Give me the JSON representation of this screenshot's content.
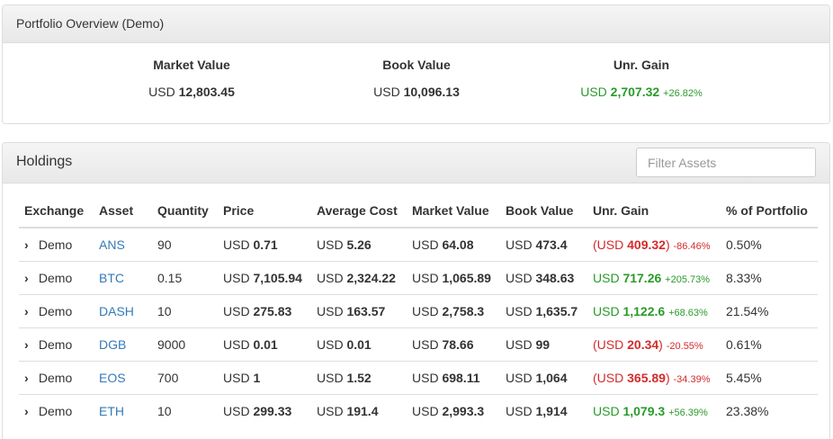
{
  "overview": {
    "title": "Portfolio Overview (Demo)",
    "market_value_label": "Market Value",
    "market_value_currency": "USD",
    "market_value": "12,803.45",
    "book_value_label": "Book Value",
    "book_value_currency": "USD",
    "book_value": "10,096.13",
    "gain_label": "Unr. Gain",
    "gain_currency": "USD",
    "gain_value": "2,707.32",
    "gain_pct": "+26.82%"
  },
  "holdings": {
    "title": "Holdings",
    "filter_placeholder": "Filter Assets",
    "columns": [
      "Exchange",
      "Asset",
      "Quantity",
      "Price",
      "Average Cost",
      "Market Value",
      "Book Value",
      "Unr. Gain",
      "% of Portfolio"
    ],
    "rows": [
      {
        "exchange": "Demo",
        "asset": "ANS",
        "quantity": "90",
        "price": "0.71",
        "avg_cost": "5.26",
        "market_value": "64.08",
        "book_value": "473.4",
        "gain_text": "(USD ",
        "gain_value": "409.32",
        "gain_close": ")",
        "gain_pct": "-86.46%",
        "gain_status": "loss",
        "portfolio_pct": "0.50%"
      },
      {
        "exchange": "Demo",
        "asset": "BTC",
        "quantity": "0.15",
        "price": "7,105.94",
        "avg_cost": "2,324.22",
        "market_value": "1,065.89",
        "book_value": "348.63",
        "gain_text": "USD ",
        "gain_value": "717.26",
        "gain_close": "",
        "gain_pct": "+205.73%",
        "gain_status": "gain",
        "portfolio_pct": "8.33%"
      },
      {
        "exchange": "Demo",
        "asset": "DASH",
        "quantity": "10",
        "price": "275.83",
        "avg_cost": "163.57",
        "market_value": "2,758.3",
        "book_value": "1,635.7",
        "gain_text": "USD ",
        "gain_value": "1,122.6",
        "gain_close": "",
        "gain_pct": "+68.63%",
        "gain_status": "gain",
        "portfolio_pct": "21.54%"
      },
      {
        "exchange": "Demo",
        "asset": "DGB",
        "quantity": "9000",
        "price": "0.01",
        "avg_cost": "0.01",
        "market_value": "78.66",
        "book_value": "99",
        "gain_text": "(USD ",
        "gain_value": "20.34",
        "gain_close": ")",
        "gain_pct": "-20.55%",
        "gain_status": "loss",
        "portfolio_pct": "0.61%"
      },
      {
        "exchange": "Demo",
        "asset": "EOS",
        "quantity": "700",
        "price": "1",
        "avg_cost": "1.52",
        "market_value": "698.11",
        "book_value": "1,064",
        "gain_text": "(USD ",
        "gain_value": "365.89",
        "gain_close": ")",
        "gain_pct": "-34.39%",
        "gain_status": "loss",
        "portfolio_pct": "5.45%"
      },
      {
        "exchange": "Demo",
        "asset": "ETH",
        "quantity": "10",
        "price": "299.33",
        "avg_cost": "191.4",
        "market_value": "2,993.3",
        "book_value": "1,914",
        "gain_text": "USD ",
        "gain_value": "1,079.3",
        "gain_close": "",
        "gain_pct": "+56.39%",
        "gain_status": "gain",
        "portfolio_pct": "23.38%"
      }
    ],
    "currency": "USD",
    "expand_icon": "chevron-right-icon"
  },
  "colors": {
    "gain": "#2a9a2a",
    "loss": "#d42b2b",
    "link": "#337ab7"
  }
}
